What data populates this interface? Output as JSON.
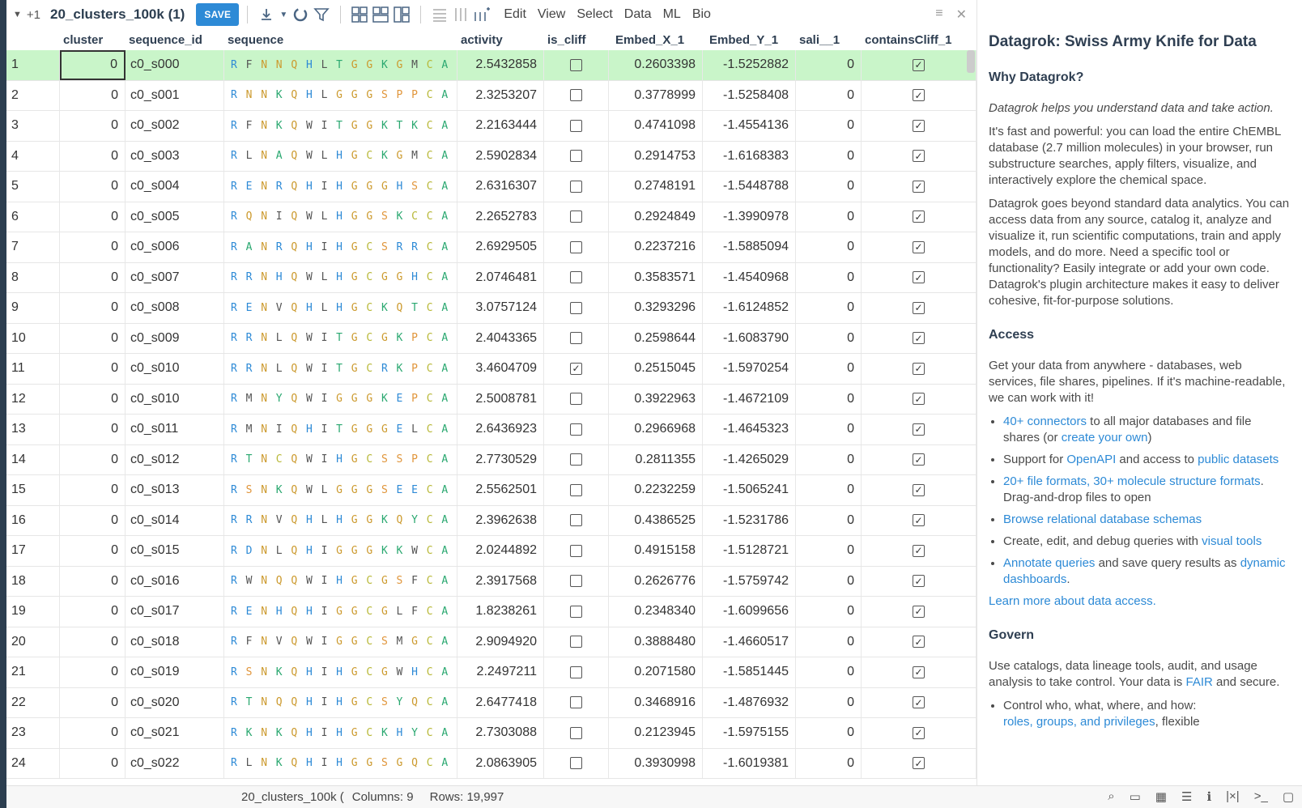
{
  "toolbar": {
    "plus_count": "+1",
    "table_title": "20_clusters_100k (1)",
    "save_label": "SAVE",
    "menus": [
      "Edit",
      "View",
      "Select",
      "Data",
      "ML",
      "Bio"
    ]
  },
  "grid": {
    "columns": [
      "cluster",
      "sequence_id",
      "sequence",
      "activity",
      "is_cliff",
      "Embed_X_1",
      "Embed_Y_1",
      "sali__1",
      "containsCliff_1"
    ],
    "rows": [
      {
        "idx": "1",
        "cluster": "0",
        "sid": "c0_s000",
        "seq": "RFNNQHLTGGKGMCA",
        "act": "2.5432858",
        "cliff": false,
        "x": "0.2603398",
        "y": "-1.5252882",
        "sali": "0",
        "cc": true
      },
      {
        "idx": "2",
        "cluster": "0",
        "sid": "c0_s001",
        "seq": "RNNKQHLGGGSPPCA",
        "act": "2.3253207",
        "cliff": false,
        "x": "0.3778999",
        "y": "-1.5258408",
        "sali": "0",
        "cc": true
      },
      {
        "idx": "3",
        "cluster": "0",
        "sid": "c0_s002",
        "seq": "RFNKQWITGGKTKCA",
        "act": "2.2163444",
        "cliff": false,
        "x": "0.4741098",
        "y": "-1.4554136",
        "sali": "0",
        "cc": true
      },
      {
        "idx": "4",
        "cluster": "0",
        "sid": "c0_s003",
        "seq": "RLNAQWLHGCKGMCA",
        "act": "2.5902834",
        "cliff": false,
        "x": "0.2914753",
        "y": "-1.6168383",
        "sali": "0",
        "cc": true
      },
      {
        "idx": "5",
        "cluster": "0",
        "sid": "c0_s004",
        "seq": "RENRQHIHGGGHSCA",
        "act": "2.6316307",
        "cliff": false,
        "x": "0.2748191",
        "y": "-1.5448788",
        "sali": "0",
        "cc": true
      },
      {
        "idx": "6",
        "cluster": "0",
        "sid": "c0_s005",
        "seq": "RQNIQWLHGGSKCCA",
        "act": "2.2652783",
        "cliff": false,
        "x": "0.2924849",
        "y": "-1.3990978",
        "sali": "0",
        "cc": true
      },
      {
        "idx": "7",
        "cluster": "0",
        "sid": "c0_s006",
        "seq": "RANRQHIHGCSRRCA",
        "act": "2.6929505",
        "cliff": false,
        "x": "0.2237216",
        "y": "-1.5885094",
        "sali": "0",
        "cc": true
      },
      {
        "idx": "8",
        "cluster": "0",
        "sid": "c0_s007",
        "seq": "RRNHQWLHGCGGHCA",
        "act": "2.0746481",
        "cliff": false,
        "x": "0.3583571",
        "y": "-1.4540968",
        "sali": "0",
        "cc": true
      },
      {
        "idx": "9",
        "cluster": "0",
        "sid": "c0_s008",
        "seq": "RENVQHLHGCKQTCA",
        "act": "3.0757124",
        "cliff": false,
        "x": "0.3293296",
        "y": "-1.6124852",
        "sali": "0",
        "cc": true
      },
      {
        "idx": "10",
        "cluster": "0",
        "sid": "c0_s009",
        "seq": "RRNLQWITGCGKPCA",
        "act": "2.4043365",
        "cliff": false,
        "x": "0.2598644",
        "y": "-1.6083790",
        "sali": "0",
        "cc": true
      },
      {
        "idx": "11",
        "cluster": "0",
        "sid": "c0_s010",
        "seq": "RRNLQWITGCRKPCA",
        "act": "3.4604709",
        "cliff": true,
        "x": "0.2515045",
        "y": "-1.5970254",
        "sali": "0",
        "cc": true
      },
      {
        "idx": "12",
        "cluster": "0",
        "sid": "c0_s010",
        "seq": "RMNYQWIGGGKEPCA",
        "act": "2.5008781",
        "cliff": false,
        "x": "0.3922963",
        "y": "-1.4672109",
        "sali": "0",
        "cc": true
      },
      {
        "idx": "13",
        "cluster": "0",
        "sid": "c0_s011",
        "seq": "RMNIQHITGGGELCA",
        "act": "2.6436923",
        "cliff": false,
        "x": "0.2966968",
        "y": "-1.4645323",
        "sali": "0",
        "cc": true
      },
      {
        "idx": "14",
        "cluster": "0",
        "sid": "c0_s012",
        "seq": "RTNCQWIHGCSSPCA",
        "act": "2.7730529",
        "cliff": false,
        "x": "0.2811355",
        "y": "-1.4265029",
        "sali": "0",
        "cc": true
      },
      {
        "idx": "15",
        "cluster": "0",
        "sid": "c0_s013",
        "seq": "RSNKQWLGGGSEECA",
        "act": "2.5562501",
        "cliff": false,
        "x": "0.2232259",
        "y": "-1.5065241",
        "sali": "0",
        "cc": true
      },
      {
        "idx": "16",
        "cluster": "0",
        "sid": "c0_s014",
        "seq": "RRNVQHLHGGKQYCA",
        "act": "2.3962638",
        "cliff": false,
        "x": "0.4386525",
        "y": "-1.5231786",
        "sali": "0",
        "cc": true
      },
      {
        "idx": "17",
        "cluster": "0",
        "sid": "c0_s015",
        "seq": "RDNLQHIGGGKKWCA",
        "act": "2.0244892",
        "cliff": false,
        "x": "0.4915158",
        "y": "-1.5128721",
        "sali": "0",
        "cc": true
      },
      {
        "idx": "18",
        "cluster": "0",
        "sid": "c0_s016",
        "seq": "RWNQQWIHGCGSFCA",
        "act": "2.3917568",
        "cliff": false,
        "x": "0.2626776",
        "y": "-1.5759742",
        "sali": "0",
        "cc": true
      },
      {
        "idx": "19",
        "cluster": "0",
        "sid": "c0_s017",
        "seq": "RENHQHIGGCGLFCA",
        "act": "1.8238261",
        "cliff": false,
        "x": "0.2348340",
        "y": "-1.6099656",
        "sali": "0",
        "cc": true
      },
      {
        "idx": "20",
        "cluster": "0",
        "sid": "c0_s018",
        "seq": "RFNVQWIGGCSMGCA",
        "act": "2.9094920",
        "cliff": false,
        "x": "0.3888480",
        "y": "-1.4660517",
        "sali": "0",
        "cc": true
      },
      {
        "idx": "21",
        "cluster": "0",
        "sid": "c0_s019",
        "seq": "RSNKQHIHGCGWHCA",
        "act": "2.2497211",
        "cliff": false,
        "x": "0.2071580",
        "y": "-1.5851445",
        "sali": "0",
        "cc": true
      },
      {
        "idx": "22",
        "cluster": "0",
        "sid": "c0_s020",
        "seq": "RTNQQHIHGCSYQCA",
        "act": "2.6477418",
        "cliff": false,
        "x": "0.3468916",
        "y": "-1.4876932",
        "sali": "0",
        "cc": true
      },
      {
        "idx": "23",
        "cluster": "0",
        "sid": "c0_s021",
        "seq": "RKNKQHIHGCKHYCA",
        "act": "2.7303088",
        "cliff": false,
        "x": "0.2123945",
        "y": "-1.5975155",
        "sali": "0",
        "cc": true
      },
      {
        "idx": "24",
        "cluster": "0",
        "sid": "c0_s022",
        "seq": "RLNKQHIHGGSGQCA",
        "act": "2.0863905",
        "cliff": false,
        "x": "0.3930998",
        "y": "-1.6019381",
        "sali": "0",
        "cc": true
      }
    ],
    "residue_colors": {
      "R": "#2d8ad6",
      "N": "#cc9a2e",
      "Q": "#cc9a2e",
      "C": "#b8b838",
      "A": "#2aa870",
      "H": "#2d8ad6",
      "G": "#cc9a2e",
      "K": "#2aa870",
      "F": "#555555",
      "L": "#555555",
      "M": "#555555",
      "I": "#555555",
      "W": "#555555",
      "V": "#555555",
      "Y": "#2aa870",
      "T": "#2aa870",
      "E": "#2d8ad6",
      "D": "#2d8ad6",
      "S": "#e0953a",
      "P": "#e0953a"
    }
  },
  "status": {
    "name": "20_clusters_100k (",
    "columns": "Columns: 9",
    "rows": "Rows: 19,997"
  },
  "panel": {
    "title": "Datagrok: Swiss Army Knife for Data",
    "why_heading": "Why Datagrok?",
    "why_italic": "Datagrok helps you understand data and take action.",
    "why_p1": "It's fast and powerful: you can load the entire ChEMBL database (2.7 million molecules) in your browser, run substructure searches, apply filters, visualize, and interactively explore the chemical space.",
    "why_p2": "Datagrok goes beyond standard data analytics. You can access data from any source, catalog it, analyze and visualize it, run scientific computations, train and apply models, and do more. Need a specific tool or functionality? Easily integrate or add your own code. Datagrok's plugin architecture makes it easy to deliver cohesive, fit-for-purpose solutions.",
    "access_heading": "Access",
    "access_p": "Get your data from anywhere - databases, web services, file shares, pipelines. If it's machine-readable, we can work with it!",
    "access_items": [
      {
        "link1": "40+ connectors",
        "text1": " to all major databases and file shares (or ",
        "link2": "create your own",
        "text2": ")"
      },
      {
        "link1": "",
        "text1": "Support for ",
        "link2": "OpenAPI",
        "text2": " and access to ",
        "link3": "public datasets"
      },
      {
        "link1": "20+ file formats, 30+ molecule structure formats",
        "text1": ". Drag-and-drop files to open"
      },
      {
        "link1": "Browse relational database schemas",
        "text1": ""
      },
      {
        "link1": "",
        "text1": "Create, edit, and debug queries with ",
        "link2": "visual tools",
        "text2": ""
      },
      {
        "link1": "Annotate queries",
        "text1": " and save query results as ",
        "link2": "dynamic dashboards",
        "text2": "."
      }
    ],
    "access_more": "Learn more about data access.",
    "govern_heading": "Govern",
    "govern_p_pre": "Use catalogs, data lineage tools, audit, and usage analysis to take control. Your data is ",
    "govern_p_link": "FAIR",
    "govern_p_post": " and secure.",
    "govern_li": "Control who, what, where, and how:",
    "govern_li_link": "roles, groups, and privileges",
    "govern_li_post": ", flexible"
  }
}
